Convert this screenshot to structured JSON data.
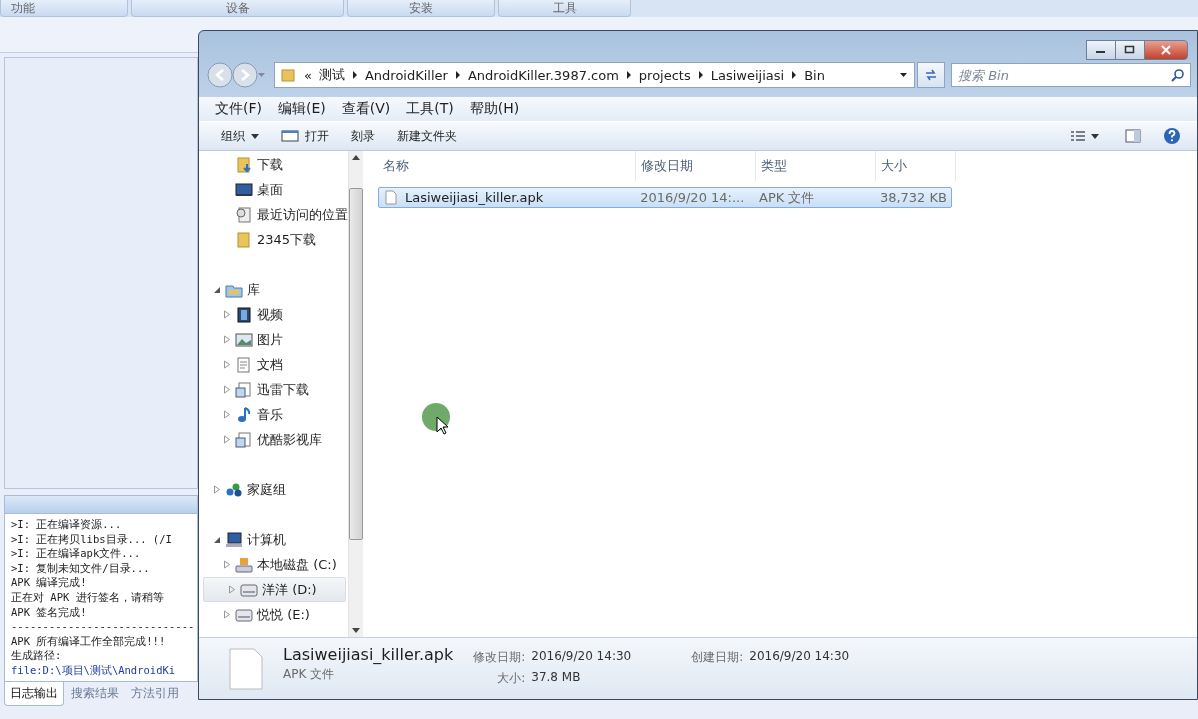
{
  "app": {
    "tabs": [
      {
        "label": "功能"
      },
      {
        "label": "设备"
      },
      {
        "label": "安装"
      },
      {
        "label": "工具"
      }
    ],
    "log_lines": [
      {
        "text": ">I: 正在编译资源...",
        "kind": "text"
      },
      {
        "text": ">I: 正在拷贝libs目录... (/I",
        "kind": "text"
      },
      {
        "text": ">I: 正在编译apk文件...",
        "kind": "text"
      },
      {
        "text": ">I: 复制未知文件/目录...",
        "kind": "text"
      },
      {
        "text": "APK 编译完成!",
        "kind": "text"
      },
      {
        "text": "正在对 APK 进行签名，请稍等",
        "kind": "text"
      },
      {
        "text": "APK 签名完成!",
        "kind": "text"
      },
      {
        "text": "-----------------------------",
        "kind": "text"
      },
      {
        "text": "APK 所有编译工作全部完成!!!",
        "kind": "text"
      },
      {
        "text": "生成路径:",
        "kind": "text"
      },
      {
        "text": "file:D:\\项目\\测试\\AndroidKi",
        "kind": "path"
      }
    ],
    "bottom_tabs": [
      {
        "label": "日志输出",
        "selected": true
      },
      {
        "label": "搜索结果",
        "selected": false
      },
      {
        "label": "方法引用",
        "selected": false
      }
    ]
  },
  "explorer": {
    "overflow_mark": "«",
    "breadcrumb": [
      "测试",
      "AndroidKiller",
      "AndroidKiller.3987.com",
      "projects",
      "Lasiweijiasi",
      "Bin"
    ],
    "search": {
      "placeholder": "搜索 Bin"
    },
    "menu": [
      "文件(F)",
      "编辑(E)",
      "查看(V)",
      "工具(T)",
      "帮助(H)"
    ],
    "toolbar": [
      {
        "label": "组织",
        "kind": "dropdown"
      },
      {
        "label": "打开",
        "kind": "open"
      },
      {
        "label": "刻录",
        "kind": "plain"
      },
      {
        "label": "新建文件夹",
        "kind": "plain"
      }
    ],
    "favorites": [
      {
        "label": "下载",
        "kind": "downloads",
        "selected": false
      },
      {
        "label": "桌面",
        "kind": "desktop",
        "selected": false
      },
      {
        "label": "最近访问的位置",
        "kind": "recent",
        "selected": false
      },
      {
        "label": "2345下载",
        "kind": "folder",
        "selected": false
      }
    ],
    "nav_tree": [
      {
        "label": "库",
        "kind": "library",
        "expanded": true,
        "selected": false,
        "children": [
          {
            "label": "视频",
            "kind": "video",
            "expanded": false,
            "selected": false
          },
          {
            "label": "图片",
            "kind": "picture",
            "expanded": false,
            "selected": false
          },
          {
            "label": "文档",
            "kind": "document",
            "expanded": false,
            "selected": false
          },
          {
            "label": "迅雷下载",
            "kind": "libfolder",
            "expanded": false,
            "selected": false
          },
          {
            "label": "音乐",
            "kind": "music",
            "expanded": false,
            "selected": false
          },
          {
            "label": "优酷影视库",
            "kind": "libfolder",
            "expanded": false,
            "selected": false
          }
        ]
      },
      {
        "label": "家庭组",
        "kind": "homegroup",
        "expanded": false,
        "selected": false
      },
      {
        "label": "计算机",
        "kind": "computer",
        "expanded": true,
        "selected": false,
        "children": [
          {
            "label": "本地磁盘 (C:)",
            "kind": "systemdrive",
            "expanded": false,
            "selected": false
          },
          {
            "label": "洋洋 (D:)",
            "kind": "drive",
            "expanded": false,
            "selected": true
          },
          {
            "label": "悦悦 (E:)",
            "kind": "drive",
            "expanded": false,
            "selected": false
          }
        ]
      }
    ],
    "columns": [
      "名称",
      "修改日期",
      "类型",
      "大小"
    ],
    "files": [
      {
        "name": "Lasiweijiasi_killer.apk",
        "modified": "2016/9/20 14:...",
        "type": "APK 文件",
        "size": "38,732 KB",
        "selected": true
      }
    ],
    "details": {
      "name": "Lasiweijiasi_killer.apk",
      "type": "APK 文件",
      "modified_label": "修改日期:",
      "modified": "2016/9/20 14:30",
      "size_label": "大小:",
      "size": "37.8 MB",
      "created_label": "创建日期:",
      "created": "2016/9/20 14:30"
    }
  }
}
